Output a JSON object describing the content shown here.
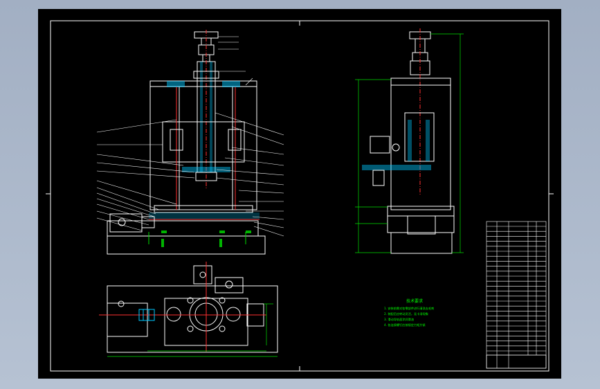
{
  "drawing": {
    "tech_requirements_title": "技术要求",
    "tech_requirements": [
      "1. 安装前需对各零部件进行清洗去毛刺",
      "2. 装配后应转动灵活，无卡滞现象",
      "3. 滑动导轨面涂润滑油",
      "4. 各连接螺钉应按规定力矩拧紧"
    ]
  },
  "colors": {
    "background": "#000000",
    "line": "#ffffff",
    "annotation": "#00ff00",
    "section": "#ff3030",
    "hatch": "#00c8ff",
    "dimension": "#00e000",
    "viewport": "#a9b6c9"
  }
}
